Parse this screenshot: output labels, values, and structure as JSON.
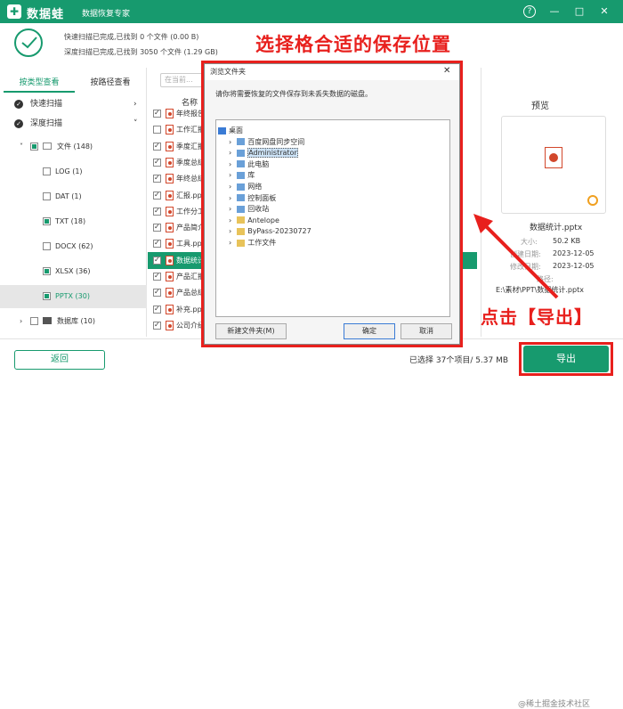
{
  "app": {
    "name": "数据蛙",
    "subtitle": "数据恢复专家",
    "logo": "✚"
  },
  "titlebar": {
    "help_icon": "?",
    "min_icon": "—",
    "max_icon": "□",
    "close_icon": "✕"
  },
  "status": {
    "line1": "快速扫描已完成,已找到 0 个文件 (0.00  B)",
    "line2": "深度扫描已完成,已找到 3050 个文件 (1.29 GB)"
  },
  "annotation_title": "选择格合适的保存位置",
  "left": {
    "tabs": [
      {
        "label": "按类型查看",
        "active": true
      },
      {
        "label": "按路径查看",
        "active": false
      }
    ],
    "scan_rows": [
      {
        "label": "快速扫描"
      },
      {
        "label": "深度扫描"
      }
    ],
    "tree": [
      {
        "label": "文件 (148)"
      },
      {
        "label": "LOG (1)"
      },
      {
        "label": "DAT (1)"
      },
      {
        "label": "TXT (18)"
      },
      {
        "label": "DOCX (62)"
      },
      {
        "label": "XLSX (36)"
      },
      {
        "label": "PPTX (30)"
      },
      {
        "label": "数据库 (10)"
      }
    ]
  },
  "center": {
    "search_placeholder": "在当前...",
    "col_name": "名称",
    "files": [
      "年终报告...",
      "工作汇报...",
      "季度汇报...",
      "季度总结...",
      "年终总结...",
      "汇报.pptx",
      "工作分工...",
      "产品简介...",
      "工具.pptx",
      "数据统计...",
      "产品汇报...",
      "产品总结...",
      "补充.pptx",
      "公司介绍..."
    ]
  },
  "right": {
    "preview_label": "预览",
    "file_name": "数据统计.pptx",
    "size_label": "大小:",
    "size": "50.2 KB",
    "created_label": "创建日期:",
    "created": "2023-12-05",
    "modified_label": "修改日期:",
    "modified": "2023-12-05",
    "path_label": "路径:",
    "path": "E:\\素材\\PPT\\数据统计.pptx"
  },
  "bottom": {
    "back": "返回",
    "selected": "已选择 37个项目/ 5.37 MB",
    "export": "导出",
    "click_note": "点击【导出】",
    "watermark": "@稀土掘金技术社区"
  },
  "dialog": {
    "title": "浏览文件夹",
    "close": "✕",
    "message": "请你将需要恢复的文件保存到未丢失数据的磁盘。",
    "items": [
      "桌面",
      "百度网盘同步空间",
      "Administrator",
      "此电脑",
      "库",
      "网络",
      "控制面板",
      "回收站",
      "Antelope",
      "ByPass-20230727",
      "工作文件"
    ],
    "new_folder": "新建文件夹(M)",
    "ok": "确定",
    "cancel": "取消"
  },
  "colors": {
    "accent": "#179a6e",
    "annotation": "#e8201d",
    "ppt": "#d2472b"
  }
}
